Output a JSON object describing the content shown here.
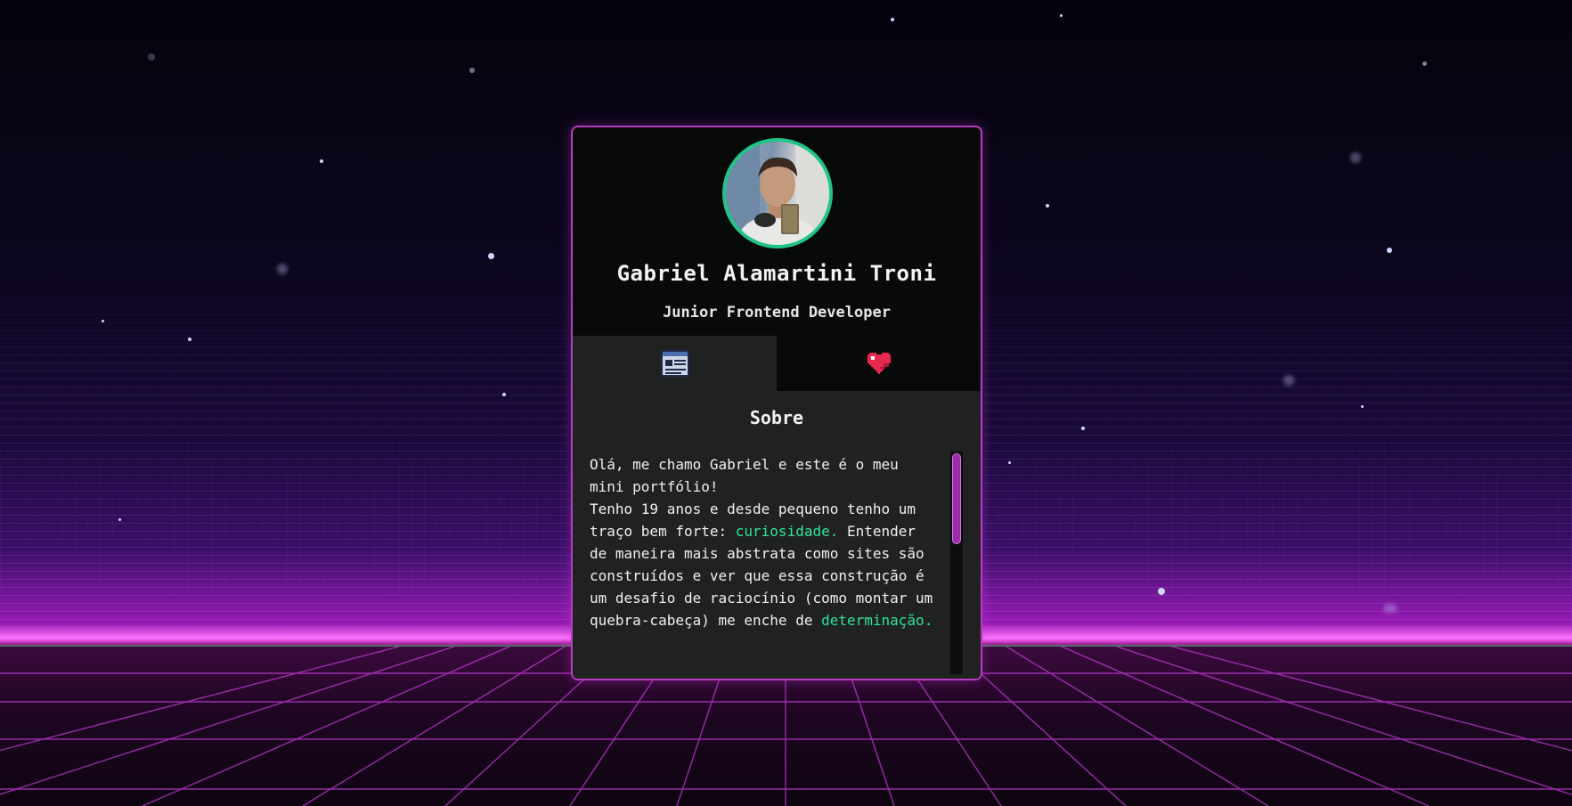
{
  "profile": {
    "name": "Gabriel Alamartini Troni",
    "role": "Junior Frontend Developer",
    "avatar_icon": "profile-photo"
  },
  "tabs": [
    {
      "icon": "document-icon",
      "active": true
    },
    {
      "icon": "heart-icon",
      "active": false
    }
  ],
  "about": {
    "title": "Sobre",
    "line1": "Olá, me chamo Gabriel e este é o meu mini portfólio!",
    "line2_start": "Tenho 19 anos e desde pequeno tenho um traço bem forte: ",
    "line2_highlight": "curiosidade.",
    "line2_end": " Entender de maneira mais abstrata como sites são construídos e ver que essa construção é um desafio de raciocínio (como montar um quebra-cabeça) me enche de ",
    "line2_highlight2": "determinação."
  },
  "colors": {
    "accent_border": "#b63cc0",
    "avatar_ring": "#21c487",
    "highlight": "#2ee59d",
    "scroll_thumb": "#9d2aa6",
    "card_bg": "#080909",
    "panel_bg": "#202121"
  }
}
